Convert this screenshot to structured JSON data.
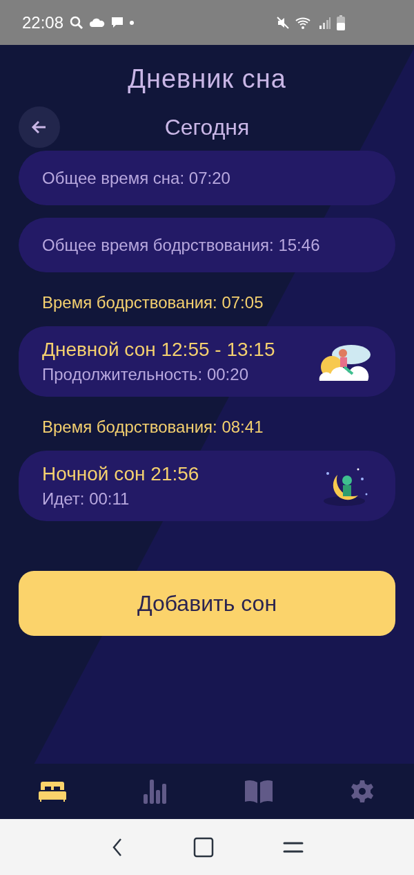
{
  "status_bar": {
    "time": "22:08"
  },
  "app_title": "Дневник сна",
  "header": {
    "title": "Сегодня"
  },
  "entries": [
    {
      "kind": "total",
      "text": "Общее время сна: 07:20"
    },
    {
      "kind": "total",
      "text": "Общее время бодрствования: 15:46"
    },
    {
      "kind": "wake",
      "text": "Время бодрствования: 07:05"
    },
    {
      "kind": "day_sleep",
      "title": "Дневной сон 12:55 - 13:15",
      "detail": "Продолжительность: 00:20"
    },
    {
      "kind": "wake",
      "text": "Время бодрствования: 08:41"
    },
    {
      "kind": "night_sleep",
      "title": "Ночной сон 21:56",
      "detail": "Идет: 00:11"
    }
  ],
  "add_button": "Добавить сон",
  "nav": [
    {
      "kind": "bed",
      "selected": true
    },
    {
      "kind": "stats",
      "selected": false
    },
    {
      "kind": "book",
      "selected": false
    },
    {
      "kind": "settings",
      "selected": false
    }
  ]
}
